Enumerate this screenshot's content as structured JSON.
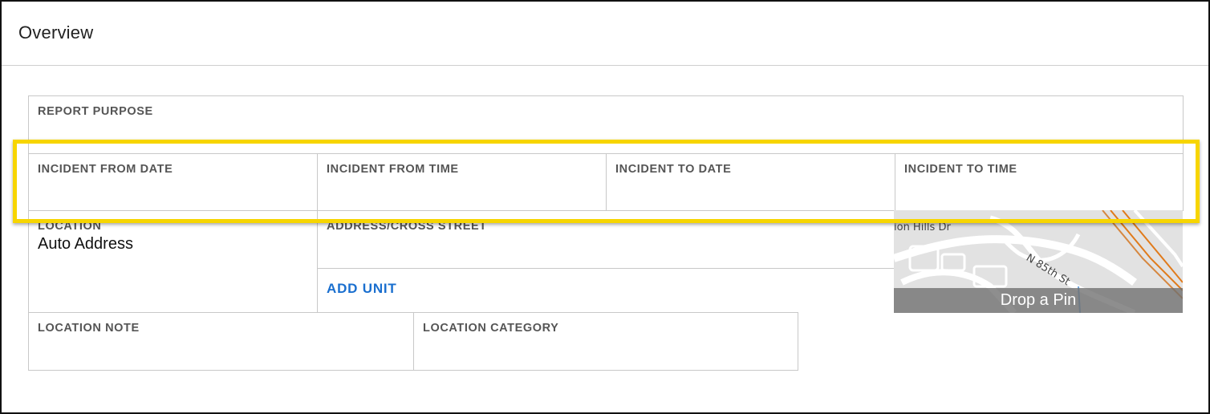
{
  "header": {
    "title": "Overview"
  },
  "fields": {
    "report_purpose": {
      "label": "REPORT PURPOSE"
    },
    "incident_from_date": {
      "label": "INCIDENT FROM DATE"
    },
    "incident_from_time": {
      "label": "INCIDENT FROM TIME"
    },
    "incident_to_date": {
      "label": "INCIDENT TO DATE"
    },
    "incident_to_time": {
      "label": "INCIDENT TO TIME"
    },
    "location": {
      "label": "LOCATION",
      "value": "Auto Address"
    },
    "address_cross_street": {
      "label": "ADDRESS/CROSS STREET"
    },
    "location_note": {
      "label": "LOCATION NOTE"
    },
    "location_category": {
      "label": "LOCATION CATEGORY"
    }
  },
  "actions": {
    "add_unit": "ADD UNIT"
  },
  "map": {
    "street_labels": [
      "ion Hills Dr",
      "N 85th St"
    ],
    "drop_pin": "Drop a Pin"
  },
  "colors": {
    "highlight": "#f7d500",
    "link": "#1a6fcf",
    "map_road_accent": "#e07a1a"
  }
}
